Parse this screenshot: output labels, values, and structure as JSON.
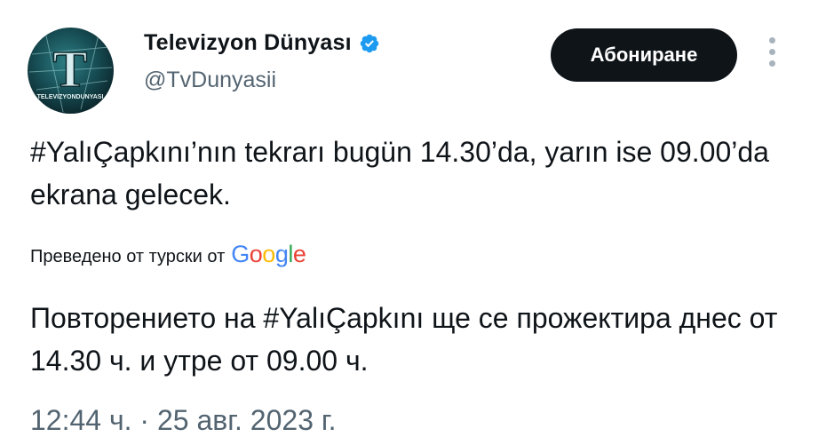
{
  "user": {
    "display_name": "Televizyon Dünyası",
    "handle": "@TvDunyasii",
    "avatar_text": "TELEVIZYONDUNYASI",
    "avatar_letter": "T",
    "verified_icon": "verified-badge-icon"
  },
  "actions": {
    "follow_label": "Абониране",
    "more_icon": "more-vertical-icon"
  },
  "tweet": {
    "text": "#YalıÇapkını’nın tekrarı bugün 14.30’da, yarın ise 09.00’da ekrana gelecek.",
    "translated_prefix": "Преведено от турски от",
    "translation_provider": [
      "G",
      "o",
      "o",
      "g",
      "l",
      "e"
    ],
    "translation": "Повторението на #YalıÇapkını ще се прожектира днес от 14.30 ч. и утре от 09.00 ч.",
    "timestamp": "12:44 ч. · 25 авг. 2023 г."
  },
  "colors": {
    "verified": "#1d9bf0",
    "button_bg": "#0f1419",
    "secondary_text": "#536471"
  }
}
